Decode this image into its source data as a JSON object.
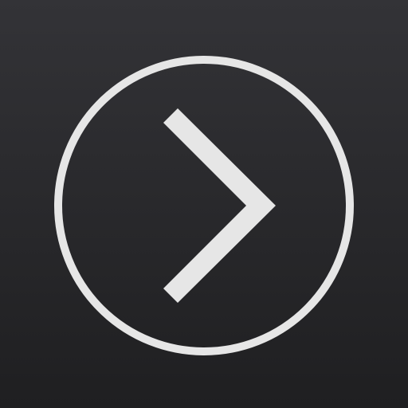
{
  "app_icon": {
    "icon": "chevron-right-in-circle-icon",
    "colors": {
      "background_top": "#333337",
      "background_bottom": "#1f1f21",
      "glyph": "#e6e6e6"
    }
  }
}
